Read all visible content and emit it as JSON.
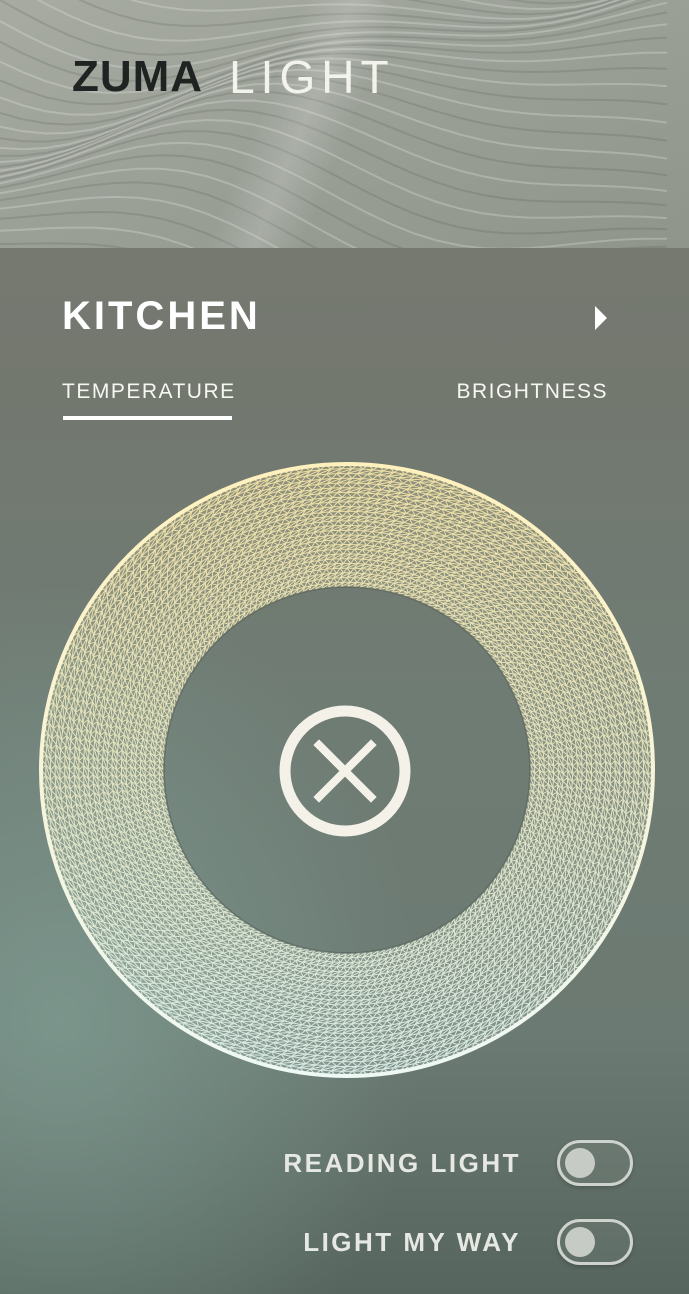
{
  "header": {
    "brand_mark": "ZUMA",
    "brand_word": "LIGHT"
  },
  "room": {
    "title": "KITCHEN"
  },
  "tabs": [
    {
      "label": "TEMPERATURE",
      "selected": true
    },
    {
      "label": "BRIGHTNESS",
      "selected": false
    }
  ],
  "dial": {
    "gradient_warm": "#f3e3a6",
    "gradient_cool": "#dbeee8",
    "center_icon": "close-icon"
  },
  "toggles": [
    {
      "label": "READING LIGHT",
      "on": false
    },
    {
      "label": "LIGHT MY WAY",
      "on": false
    }
  ],
  "icons": {
    "room_next": "chevron-right-icon"
  },
  "colors": {
    "text_primary": "#ffffff",
    "brand_dark": "#1f2422",
    "toggle_outline": "#cfd3ce"
  }
}
